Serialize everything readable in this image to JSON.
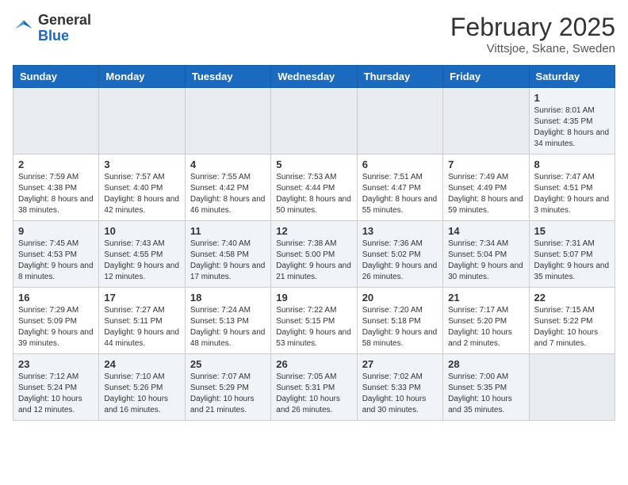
{
  "logo": {
    "general": "General",
    "blue": "Blue"
  },
  "title": "February 2025",
  "location": "Vittsjoe, Skane, Sweden",
  "days_of_week": [
    "Sunday",
    "Monday",
    "Tuesday",
    "Wednesday",
    "Thursday",
    "Friday",
    "Saturday"
  ],
  "weeks": [
    [
      {
        "day": "",
        "info": ""
      },
      {
        "day": "",
        "info": ""
      },
      {
        "day": "",
        "info": ""
      },
      {
        "day": "",
        "info": ""
      },
      {
        "day": "",
        "info": ""
      },
      {
        "day": "",
        "info": ""
      },
      {
        "day": "1",
        "info": "Sunrise: 8:01 AM\nSunset: 4:35 PM\nDaylight: 8 hours and 34 minutes."
      }
    ],
    [
      {
        "day": "2",
        "info": "Sunrise: 7:59 AM\nSunset: 4:38 PM\nDaylight: 8 hours and 38 minutes."
      },
      {
        "day": "3",
        "info": "Sunrise: 7:57 AM\nSunset: 4:40 PM\nDaylight: 8 hours and 42 minutes."
      },
      {
        "day": "4",
        "info": "Sunrise: 7:55 AM\nSunset: 4:42 PM\nDaylight: 8 hours and 46 minutes."
      },
      {
        "day": "5",
        "info": "Sunrise: 7:53 AM\nSunset: 4:44 PM\nDaylight: 8 hours and 50 minutes."
      },
      {
        "day": "6",
        "info": "Sunrise: 7:51 AM\nSunset: 4:47 PM\nDaylight: 8 hours and 55 minutes."
      },
      {
        "day": "7",
        "info": "Sunrise: 7:49 AM\nSunset: 4:49 PM\nDaylight: 8 hours and 59 minutes."
      },
      {
        "day": "8",
        "info": "Sunrise: 7:47 AM\nSunset: 4:51 PM\nDaylight: 9 hours and 3 minutes."
      }
    ],
    [
      {
        "day": "9",
        "info": "Sunrise: 7:45 AM\nSunset: 4:53 PM\nDaylight: 9 hours and 8 minutes."
      },
      {
        "day": "10",
        "info": "Sunrise: 7:43 AM\nSunset: 4:55 PM\nDaylight: 9 hours and 12 minutes."
      },
      {
        "day": "11",
        "info": "Sunrise: 7:40 AM\nSunset: 4:58 PM\nDaylight: 9 hours and 17 minutes."
      },
      {
        "day": "12",
        "info": "Sunrise: 7:38 AM\nSunset: 5:00 PM\nDaylight: 9 hours and 21 minutes."
      },
      {
        "day": "13",
        "info": "Sunrise: 7:36 AM\nSunset: 5:02 PM\nDaylight: 9 hours and 26 minutes."
      },
      {
        "day": "14",
        "info": "Sunrise: 7:34 AM\nSunset: 5:04 PM\nDaylight: 9 hours and 30 minutes."
      },
      {
        "day": "15",
        "info": "Sunrise: 7:31 AM\nSunset: 5:07 PM\nDaylight: 9 hours and 35 minutes."
      }
    ],
    [
      {
        "day": "16",
        "info": "Sunrise: 7:29 AM\nSunset: 5:09 PM\nDaylight: 9 hours and 39 minutes."
      },
      {
        "day": "17",
        "info": "Sunrise: 7:27 AM\nSunset: 5:11 PM\nDaylight: 9 hours and 44 minutes."
      },
      {
        "day": "18",
        "info": "Sunrise: 7:24 AM\nSunset: 5:13 PM\nDaylight: 9 hours and 48 minutes."
      },
      {
        "day": "19",
        "info": "Sunrise: 7:22 AM\nSunset: 5:15 PM\nDaylight: 9 hours and 53 minutes."
      },
      {
        "day": "20",
        "info": "Sunrise: 7:20 AM\nSunset: 5:18 PM\nDaylight: 9 hours and 58 minutes."
      },
      {
        "day": "21",
        "info": "Sunrise: 7:17 AM\nSunset: 5:20 PM\nDaylight: 10 hours and 2 minutes."
      },
      {
        "day": "22",
        "info": "Sunrise: 7:15 AM\nSunset: 5:22 PM\nDaylight: 10 hours and 7 minutes."
      }
    ],
    [
      {
        "day": "23",
        "info": "Sunrise: 7:12 AM\nSunset: 5:24 PM\nDaylight: 10 hours and 12 minutes."
      },
      {
        "day": "24",
        "info": "Sunrise: 7:10 AM\nSunset: 5:26 PM\nDaylight: 10 hours and 16 minutes."
      },
      {
        "day": "25",
        "info": "Sunrise: 7:07 AM\nSunset: 5:29 PM\nDaylight: 10 hours and 21 minutes."
      },
      {
        "day": "26",
        "info": "Sunrise: 7:05 AM\nSunset: 5:31 PM\nDaylight: 10 hours and 26 minutes."
      },
      {
        "day": "27",
        "info": "Sunrise: 7:02 AM\nSunset: 5:33 PM\nDaylight: 10 hours and 30 minutes."
      },
      {
        "day": "28",
        "info": "Sunrise: 7:00 AM\nSunset: 5:35 PM\nDaylight: 10 hours and 35 minutes."
      },
      {
        "day": "",
        "info": ""
      }
    ]
  ]
}
